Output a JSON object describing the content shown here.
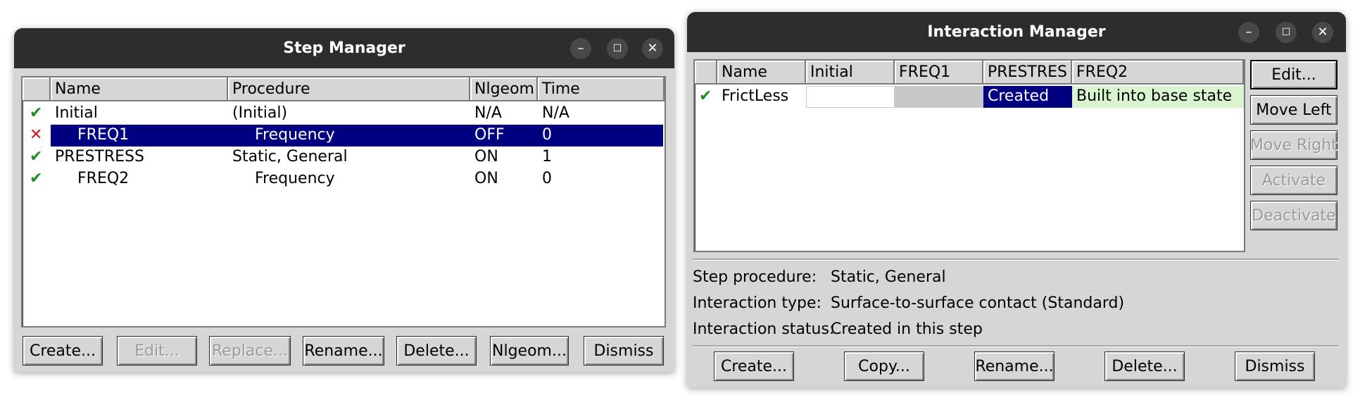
{
  "step_manager": {
    "title": "Step Manager",
    "columns": [
      "Name",
      "Procedure",
      "Nlgeom",
      "Time"
    ],
    "rows": [
      {
        "status": "✔",
        "name": "Initial",
        "procedure": "(Initial)",
        "nlgeom": "N/A",
        "time": "N/A",
        "selected": false
      },
      {
        "status": "✕",
        "name": "FREQ1",
        "procedure": "Frequency",
        "nlgeom": "OFF",
        "time": "0",
        "selected": true
      },
      {
        "status": "✔",
        "name": "PRESTRESS",
        "procedure": "Static, General",
        "nlgeom": "ON",
        "time": "1",
        "selected": false
      },
      {
        "status": "✔",
        "name": "FREQ2",
        "procedure": "Frequency",
        "nlgeom": "ON",
        "time": "0",
        "selected": false
      }
    ],
    "buttons": {
      "create": "Create...",
      "edit": "Edit...",
      "replace": "Replace...",
      "rename": "Rename...",
      "delete": "Delete...",
      "nlgeom": "Nlgeom...",
      "dismiss": "Dismiss"
    }
  },
  "interaction_manager": {
    "title": "Interaction Manager",
    "columns": [
      "Name",
      "Initial",
      "FREQ1",
      "PRESTRES",
      "FREQ2"
    ],
    "rows": [
      {
        "status": "✔",
        "name": "FrictLess",
        "initial": "",
        "freq1": "",
        "prestress": "Created",
        "freq2": "Built into base state"
      }
    ],
    "side_buttons": {
      "edit": "Edit...",
      "move_left": "Move Left",
      "move_right": "Move Right",
      "activate": "Activate",
      "deactivate": "Deactivate"
    },
    "info": {
      "step_procedure_label": "Step procedure:",
      "step_procedure_value": "Static, General",
      "interaction_type_label": "Interaction type:",
      "interaction_type_value": "Surface-to-surface contact (Standard)",
      "interaction_status_label": "Interaction status:",
      "interaction_status_value": "Created in this step"
    },
    "buttons": {
      "create": "Create...",
      "copy": "Copy...",
      "rename": "Rename...",
      "delete": "Delete...",
      "dismiss": "Dismiss"
    }
  },
  "window_controls": {
    "minimize": "–",
    "maximize": "☐",
    "close": "✕"
  },
  "colors": {
    "selection": "#000080",
    "created_cell": "#000080",
    "base_state_cell": "#d8f5d0",
    "titlebar": "#2d2d2d",
    "check": "#1e8f1e",
    "cross": "#d01818"
  }
}
